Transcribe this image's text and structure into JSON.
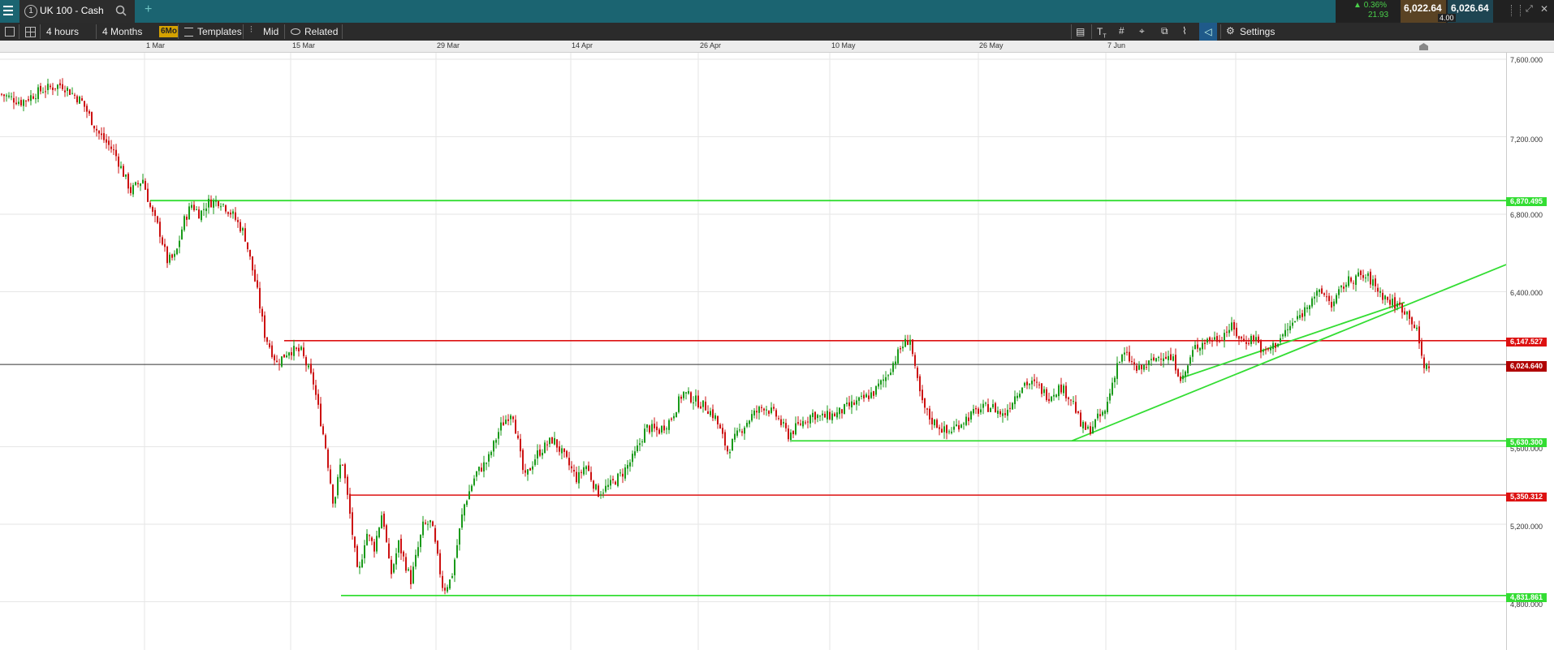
{
  "tab": {
    "number": "1",
    "title": "UK 100 - Cash"
  },
  "quote": {
    "change_pct": "0.36%",
    "change_pts": "21.93",
    "sell": "6,022.64",
    "buy": "6,026.64",
    "spread": "4.00"
  },
  "toolbar": {
    "interval": "4 hours",
    "range": "4 Months",
    "range_badge": "6Mo",
    "templates": "Templates",
    "price_type": "Mid",
    "related": "Related",
    "settings": "Settings"
  },
  "time_labels": [
    "1 Mar",
    "15 Mar",
    "29 Mar",
    "14 Apr",
    "26 Apr",
    "10 May",
    "26 May",
    "7 Jun"
  ],
  "price_ticks": [
    "7,600.000",
    "7,200.000",
    "6,800.000",
    "6,400.000",
    "5,600.000",
    "5,200.000",
    "4,800.000"
  ],
  "levels": [
    {
      "value": "6,870.495",
      "color": "#33dd33"
    },
    {
      "value": "6,147.527",
      "color": "#dd1111"
    },
    {
      "value": "6,024.640",
      "color": "#b00000"
    },
    {
      "value": "5,630.300",
      "color": "#33dd33"
    },
    {
      "value": "5,350.312",
      "color": "#dd1111"
    },
    {
      "value": "4,831.861",
      "color": "#33dd33"
    }
  ],
  "chart_data": {
    "type": "candlestick",
    "symbol": "UK 100 - Cash",
    "ylim": [
      4620,
      7620
    ],
    "close_path": [
      [
        0,
        7420
      ],
      [
        25,
        7380
      ],
      [
        50,
        7440
      ],
      [
        75,
        7470
      ],
      [
        100,
        7380
      ],
      [
        120,
        7220
      ],
      [
        140,
        7120
      ],
      [
        160,
        6920
      ],
      [
        175,
        6980
      ],
      [
        185,
        6820
      ],
      [
        195,
        6720
      ],
      [
        205,
        6560
      ],
      [
        215,
        6580
      ],
      [
        225,
        6760
      ],
      [
        235,
        6850
      ],
      [
        245,
        6800
      ],
      [
        255,
        6860
      ],
      [
        270,
        6870
      ],
      [
        285,
        6800
      ],
      [
        300,
        6700
      ],
      [
        315,
        6420
      ],
      [
        325,
        6180
      ],
      [
        340,
        6030
      ],
      [
        355,
        6100
      ],
      [
        370,
        6090
      ],
      [
        385,
        5930
      ],
      [
        400,
        5600
      ],
      [
        410,
        5300
      ],
      [
        420,
        5550
      ],
      [
        430,
        5250
      ],
      [
        440,
        4920
      ],
      [
        450,
        5160
      ],
      [
        460,
        5080
      ],
      [
        470,
        5270
      ],
      [
        480,
        4930
      ],
      [
        490,
        5100
      ],
      [
        505,
        4910
      ],
      [
        520,
        5190
      ],
      [
        530,
        5210
      ],
      [
        545,
        4860
      ],
      [
        555,
        4920
      ],
      [
        570,
        5290
      ],
      [
        585,
        5460
      ],
      [
        600,
        5530
      ],
      [
        615,
        5700
      ],
      [
        630,
        5790
      ],
      [
        645,
        5430
      ],
      [
        660,
        5560
      ],
      [
        680,
        5640
      ],
      [
        695,
        5540
      ],
      [
        710,
        5430
      ],
      [
        720,
        5510
      ],
      [
        735,
        5360
      ],
      [
        750,
        5400
      ],
      [
        765,
        5460
      ],
      [
        780,
        5550
      ],
      [
        795,
        5700
      ],
      [
        810,
        5680
      ],
      [
        825,
        5740
      ],
      [
        840,
        5880
      ],
      [
        855,
        5840
      ],
      [
        870,
        5800
      ],
      [
        880,
        5750
      ],
      [
        895,
        5580
      ],
      [
        910,
        5680
      ],
      [
        925,
        5760
      ],
      [
        940,
        5810
      ],
      [
        955,
        5760
      ],
      [
        970,
        5660
      ],
      [
        985,
        5720
      ],
      [
        1000,
        5770
      ],
      [
        1010,
        5750
      ],
      [
        1030,
        5770
      ],
      [
        1045,
        5810
      ],
      [
        1060,
        5840
      ],
      [
        1075,
        5880
      ],
      [
        1090,
        5960
      ],
      [
        1100,
        6040
      ],
      [
        1110,
        6120
      ],
      [
        1120,
        6160
      ],
      [
        1126,
        5990
      ],
      [
        1135,
        5820
      ],
      [
        1145,
        5740
      ],
      [
        1155,
        5710
      ],
      [
        1165,
        5670
      ],
      [
        1175,
        5700
      ],
      [
        1190,
        5750
      ],
      [
        1205,
        5790
      ],
      [
        1220,
        5810
      ],
      [
        1235,
        5760
      ],
      [
        1250,
        5870
      ],
      [
        1260,
        5930
      ],
      [
        1275,
        5920
      ],
      [
        1290,
        5860
      ],
      [
        1305,
        5910
      ],
      [
        1320,
        5840
      ],
      [
        1330,
        5710
      ],
      [
        1340,
        5680
      ],
      [
        1350,
        5740
      ],
      [
        1360,
        5780
      ],
      [
        1375,
        6030
      ],
      [
        1385,
        6080
      ],
      [
        1400,
        5990
      ],
      [
        1415,
        6030
      ],
      [
        1430,
        6080
      ],
      [
        1445,
        6040
      ],
      [
        1455,
        5940
      ],
      [
        1470,
        6110
      ],
      [
        1485,
        6150
      ],
      [
        1500,
        6160
      ],
      [
        1515,
        6220
      ],
      [
        1530,
        6140
      ],
      [
        1545,
        6170
      ],
      [
        1555,
        6080
      ],
      [
        1570,
        6130
      ],
      [
        1590,
        6230
      ],
      [
        1605,
        6300
      ],
      [
        1615,
        6380
      ],
      [
        1630,
        6390
      ],
      [
        1640,
        6330
      ],
      [
        1655,
        6440
      ],
      [
        1670,
        6480
      ],
      [
        1685,
        6470
      ],
      [
        1700,
        6390
      ],
      [
        1710,
        6350
      ],
      [
        1725,
        6320
      ],
      [
        1735,
        6280
      ],
      [
        1745,
        6180
      ],
      [
        1750,
        6060
      ],
      [
        1755,
        6000
      ],
      [
        1760,
        6030
      ]
    ]
  }
}
